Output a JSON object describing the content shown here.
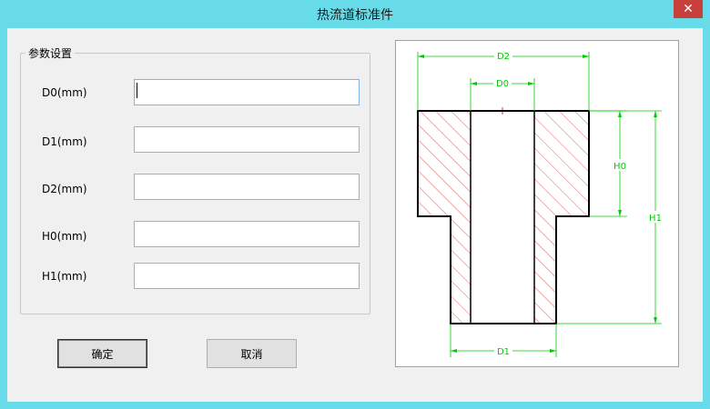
{
  "window": {
    "title": "热流道标准件",
    "close_glyph": "✕"
  },
  "params": {
    "group_label": "参数设置",
    "fields": [
      {
        "label": "D0(mm)",
        "value": ""
      },
      {
        "label": "D1(mm)",
        "value": ""
      },
      {
        "label": "D2(mm)",
        "value": ""
      },
      {
        "label": "H0(mm)",
        "value": ""
      },
      {
        "label": "H1(mm)",
        "value": ""
      }
    ]
  },
  "buttons": {
    "ok_label": "确定",
    "cancel_label": "取消"
  },
  "diagram": {
    "labels": {
      "d2": "D2",
      "d0": "D0",
      "d1": "D1",
      "h0": "H0",
      "h1": "H1"
    },
    "colors": {
      "outline": "#000000",
      "hatch": "#e53030",
      "dimension": "#00cc00",
      "centerline": "#e53030"
    }
  }
}
